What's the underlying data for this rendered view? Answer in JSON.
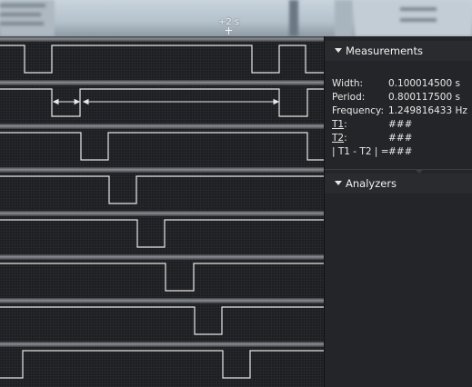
{
  "cursor": {
    "label": "+2 s"
  },
  "measurements": {
    "title": "Measurements",
    "rows": [
      {
        "label": "Width:",
        "value": "0.100014500 s",
        "underline": false
      },
      {
        "label": "Period:",
        "value": "0.800117500 s",
        "underline": false
      },
      {
        "label": "Frequency:",
        "value": "1.249816433 Hz",
        "underline": false
      },
      {
        "label": "T1",
        "suffix": ":",
        "value": "###",
        "underline": true
      },
      {
        "label": "T2",
        "suffix": ":",
        "value": "###",
        "underline": true
      },
      {
        "label": "| T1 - T2 | =",
        "value": "###",
        "underline": false
      }
    ]
  },
  "analyzers": {
    "title": "Analyzers"
  },
  "colors": {
    "background": "#1d1e21",
    "trace": "#e8e8e8",
    "panel": "#242528"
  },
  "icons": [
    "triangle-down-icon",
    "double-arrow-icon"
  ]
}
